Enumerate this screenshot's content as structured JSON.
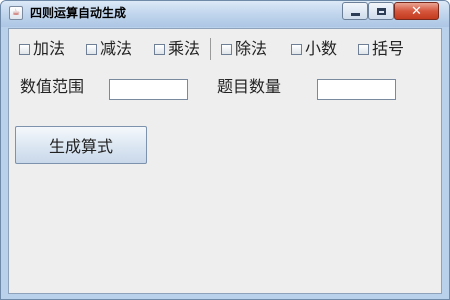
{
  "window": {
    "title": "四则运算自动生成",
    "icon": "java-cup-icon",
    "controls": [
      "minimize-icon",
      "maximize-icon",
      "close-icon"
    ]
  },
  "options": [
    {
      "label": "加法",
      "checked": false
    },
    {
      "label": "减法",
      "checked": false
    },
    {
      "label": "乘法",
      "checked": false
    },
    {
      "label": "除法",
      "checked": false
    },
    {
      "label": "小数",
      "checked": false
    },
    {
      "label": "括号",
      "checked": false
    }
  ],
  "fields": {
    "range_label": "数值范围",
    "range_value": "",
    "count_label": "题目数量",
    "count_value": ""
  },
  "actions": {
    "generate_label": "生成算式"
  },
  "colors": {
    "content_bg": "#eeeeee",
    "frame": "#b9d1ea",
    "close_button": "#c33a1f"
  }
}
